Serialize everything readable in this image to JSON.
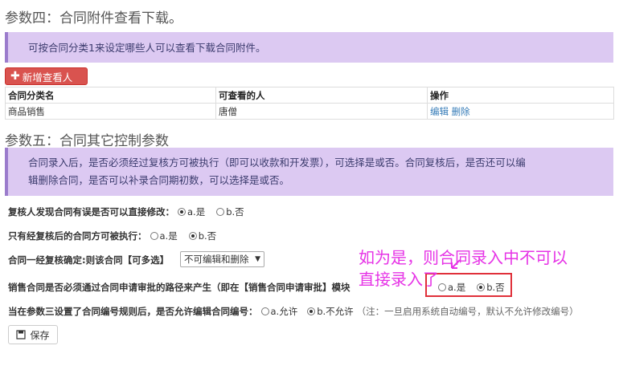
{
  "section4": {
    "title": "参数四：合同附件查看下载。",
    "info": "可按合同分类1来设定哪些人可以查看下载合同附件。",
    "add_button": "新增查看人",
    "table": {
      "headers": [
        "合同分类名",
        "可查看的人",
        "操作"
      ],
      "rows": [
        {
          "category": "商品销售",
          "viewer": "唐僧",
          "edit": "编辑",
          "delete": "删除"
        }
      ]
    }
  },
  "section5": {
    "title": "参数五：合同其它控制参数",
    "info_line1": "合同录入后，是否必须经过复核方可被执行（即可以收款和开发票），可选择是或否。合同复核后，是否还可以编",
    "info_line2": "辑删除合同，是否可以补录合同期初数，可以选择是或否。",
    "q1": {
      "label": "复核人发现合同有误是否可以直接修改：",
      "opt_a": "a.是",
      "opt_b": "b.否",
      "selected": "a"
    },
    "q2": {
      "label": "只有经复核后的合同方可被执行：",
      "opt_a": "a.是",
      "opt_b": "b.否",
      "selected": "b"
    },
    "q3": {
      "label": "合同一经复核确定:则该合同【可多选】",
      "select_value": "不可编辑和删除"
    },
    "q4": {
      "label": "销售合同是否必须通过合同申请审批的路径来产生（即在【销售合同申请审批】模块",
      "opt_a": "a.是",
      "opt_b": "b.否",
      "selected": "b"
    },
    "q5": {
      "label": "当在参数三设置了合同编号规则后，是否允许编辑合同编号：",
      "opt_a": "a.允许",
      "opt_b": "b.不允许",
      "note": "（注：一旦启用系统自动编号，默认不允许修改编号）",
      "selected": "b"
    },
    "save_button": "保存"
  },
  "annotation": {
    "line1": "如为是，则合同录入中不可以",
    "line2": "直接录入了",
    "color": "#e633e6"
  }
}
